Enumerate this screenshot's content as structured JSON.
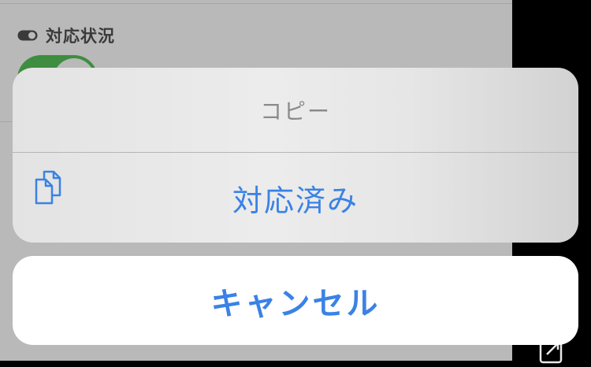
{
  "background_form": {
    "field_label": "対応状況",
    "toggle_icon": "toggle-icon",
    "switch_state": "on",
    "corner_icon": "share-icon"
  },
  "action_sheet": {
    "title": "コピー",
    "action": {
      "label": "対応済み",
      "icon": "copy-icon"
    },
    "cancel_label": "キャンセル"
  },
  "colors": {
    "accent": "#3a82e5",
    "switch_on": "#3e8d40",
    "dim_background": "#b9b9b9",
    "title_text": "#8a8a8a"
  }
}
